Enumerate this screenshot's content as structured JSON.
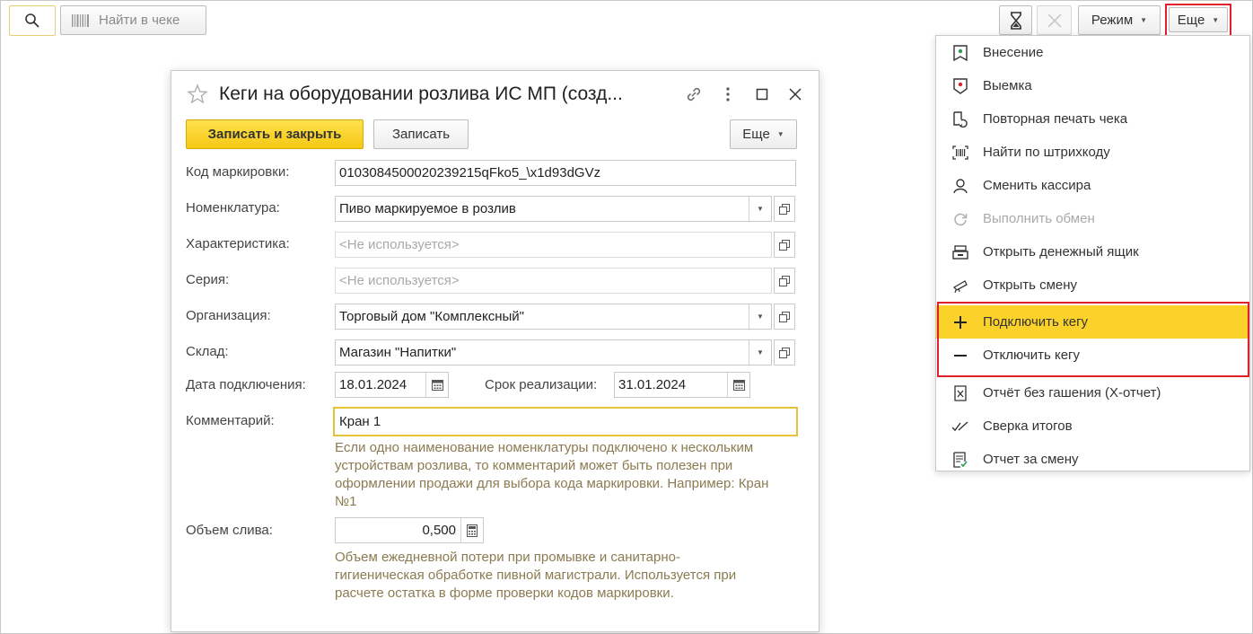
{
  "toolbar": {
    "find_placeholder": "Найти в чеке",
    "mode_label": "Режим",
    "more_label": "Еще"
  },
  "dialog": {
    "title": "Кеги на оборудовании розлива ИС МП (созд...",
    "save_close_label": "Записать и закрыть",
    "save_label": "Записать",
    "more_label": "Еще",
    "fields": {
      "marking_code": {
        "label": "Код маркировки:",
        "value": "0103084500020239215qFko5_\\x1d93dGVz"
      },
      "nomenclature": {
        "label": "Номенклатура:",
        "value": "Пиво маркируемое в розлив"
      },
      "characteristic": {
        "label": "Характеристика:",
        "value": "<Не используется>"
      },
      "series": {
        "label": "Серия:",
        "value": "<Не используется>"
      },
      "organization": {
        "label": "Организация:",
        "value": "Торговый дом \"Комплексный\""
      },
      "warehouse": {
        "label": "Склад:",
        "value": "Магазин \"Напитки\""
      },
      "connect_date": {
        "label": "Дата подключения:",
        "value": "18.01.2024"
      },
      "expiry_date": {
        "label": "Срок реализации:",
        "value": "31.01.2024"
      },
      "comment": {
        "label": "Комментарий:",
        "value": "Кран 1",
        "hint": "Если одно наименование номенклатуры подключено к нескольким устройствам розлива, то комментарий может быть полезен при оформлении продажи для выбора кода маркировки. Например: Кран №1"
      },
      "drain_volume": {
        "label": "Объем слива:",
        "value": "0,500",
        "hint": "Объем ежедневной потери при промывке и санитарно-гигиеническая обработке пивной магистрали. Используется при расчете остатка в форме проверки кодов маркировки."
      }
    }
  },
  "menu": {
    "items": [
      {
        "label": "Внесение",
        "icon": "cash-in-icon",
        "enabled": true
      },
      {
        "label": "Выемка",
        "icon": "cash-out-icon",
        "enabled": true
      },
      {
        "label": "Повторная печать чека",
        "icon": "reprint-receipt-icon",
        "enabled": true
      },
      {
        "label": "Найти по штрихкоду",
        "icon": "barcode-scan-icon",
        "enabled": true
      },
      {
        "label": "Сменить кассира",
        "icon": "user-icon",
        "enabled": true
      },
      {
        "label": "Выполнить обмен",
        "icon": "refresh-icon",
        "enabled": false
      },
      {
        "label": "Открыть денежный ящик",
        "icon": "cash-drawer-icon",
        "enabled": true
      },
      {
        "label": "Открыть смену",
        "icon": "open-shift-icon",
        "enabled": true
      },
      {
        "label": "Подключить кегу",
        "icon": "plus-icon",
        "enabled": true,
        "highlighted": true
      },
      {
        "label": "Отключить кегу",
        "icon": "minus-icon",
        "enabled": true
      },
      {
        "label": "Отчёт без гашения (X-отчет)",
        "icon": "x-report-icon",
        "enabled": true
      },
      {
        "label": "Сверка итогов",
        "icon": "check-marks-icon",
        "enabled": true
      },
      {
        "label": "Отчет за смену",
        "icon": "shift-report-icon",
        "enabled": true
      }
    ]
  },
  "colors": {
    "accent_yellow": "#fbd229",
    "primary_button": "#f5c814",
    "annotation_red": "#e0202a",
    "hint_text": "#8c7b51",
    "active_field_border": "#e6c23a"
  }
}
